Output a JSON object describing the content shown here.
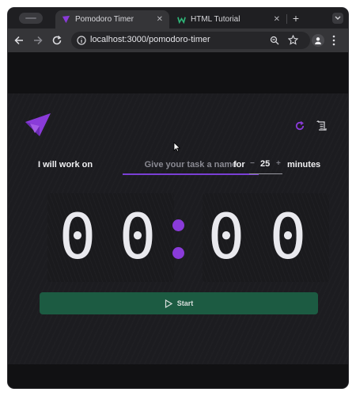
{
  "browser": {
    "tabs": [
      {
        "title": "Pomodoro Timer",
        "active": true,
        "favicon": "pomodoro-favicon"
      },
      {
        "title": "HTML Tutorial",
        "active": false,
        "favicon": "w3schools-favicon"
      }
    ],
    "close_glyph": "✕",
    "newtab_glyph": "+",
    "url": "localhost:3000/pomodoro-timer"
  },
  "app": {
    "task_prefix": "I will work on",
    "task_placeholder": "Give your task a name",
    "task_value": "",
    "for_label": "for",
    "minutes_value": "25",
    "minus_glyph": "−",
    "plus_glyph": "+",
    "minutes_label": "minutes",
    "timer": {
      "min_tens": "0",
      "min_ones": "0",
      "sec_tens": "0",
      "sec_ones": "0"
    },
    "start_label": "Start"
  },
  "colors": {
    "accent": "#7a3fd6",
    "colon": "#8a3bd9",
    "start_button": "#1c5b42",
    "background": "#1c1c20"
  }
}
